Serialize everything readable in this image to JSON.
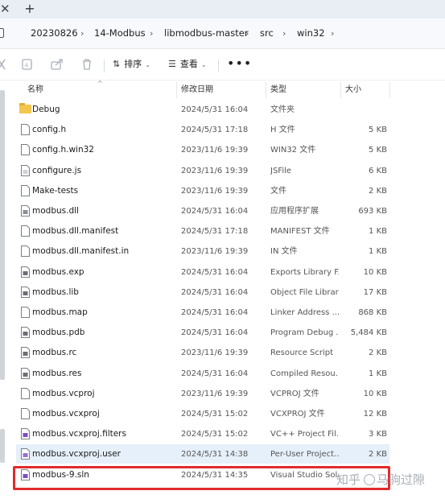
{
  "tabstrip": {
    "close_glyph": "✕",
    "new_tab_glyph": "+"
  },
  "breadcrumb": [
    "20230826",
    "14-Modbus",
    "libmodbus-master",
    "src",
    "win32"
  ],
  "toolbar": {
    "sort_label": "排序",
    "view_label": "查看",
    "more_label": "•••",
    "icons": [
      "rename-icon",
      "share-icon",
      "delete-icon",
      "sort-icon",
      "view-icon"
    ]
  },
  "columns": {
    "name": "名称",
    "date": "修改日期",
    "type": "类型",
    "size": "大小"
  },
  "files": [
    {
      "name": "Debug",
      "date": "2024/5/31 16:04",
      "type": "文件夹",
      "size": "",
      "icon": "folder-icon"
    },
    {
      "name": "config.h",
      "date": "2024/5/31 17:18",
      "type": "H 文件",
      "size": "5 KB",
      "icon": "file-icon"
    },
    {
      "name": "config.h.win32",
      "date": "2023/11/6 19:39",
      "type": "WIN32 文件",
      "size": "5 KB",
      "icon": "file-icon"
    },
    {
      "name": "configure.js",
      "date": "2023/11/6 19:39",
      "type": "JSFile",
      "size": "6 KB",
      "icon": "script-file-icon"
    },
    {
      "name": "Make-tests",
      "date": "2023/11/6 19:39",
      "type": "文件",
      "size": "2 KB",
      "icon": "file-icon"
    },
    {
      "name": "modbus.dll",
      "date": "2024/5/31 16:04",
      "type": "应用程序扩展",
      "size": "693 KB",
      "icon": "dll-file-icon"
    },
    {
      "name": "modbus.dll.manifest",
      "date": "2024/5/31 17:18",
      "type": "MANIFEST 文件",
      "size": "1 KB",
      "icon": "file-icon"
    },
    {
      "name": "modbus.dll.manifest.in",
      "date": "2023/11/6 19:39",
      "type": "IN 文件",
      "size": "1 KB",
      "icon": "file-icon"
    },
    {
      "name": "modbus.exp",
      "date": "2024/5/31 16:04",
      "type": "Exports Library F...",
      "size": "10 KB",
      "icon": "exp-file-icon"
    },
    {
      "name": "modbus.lib",
      "date": "2024/5/31 16:04",
      "type": "Object File Library",
      "size": "17 KB",
      "icon": "lib-file-icon"
    },
    {
      "name": "modbus.map",
      "date": "2024/5/31 16:04",
      "type": "Linker Address ...",
      "size": "868 KB",
      "icon": "file-icon"
    },
    {
      "name": "modbus.pdb",
      "date": "2024/5/31 16:04",
      "type": "Program Debug ...",
      "size": "5,484 KB",
      "icon": "pdb-file-icon"
    },
    {
      "name": "modbus.rc",
      "date": "2023/11/6 19:39",
      "type": "Resource Script",
      "size": "2 KB",
      "icon": "rc-file-icon"
    },
    {
      "name": "modbus.res",
      "date": "2024/5/31 16:04",
      "type": "Compiled Resou...",
      "size": "1 KB",
      "icon": "res-file-icon"
    },
    {
      "name": "modbus.vcproj",
      "date": "2023/11/6 19:39",
      "type": "VCPROJ 文件",
      "size": "10 KB",
      "icon": "file-icon"
    },
    {
      "name": "modbus.vcxproj",
      "date": "2024/5/31 15:02",
      "type": "VCXPROJ 文件",
      "size": "12 KB",
      "icon": "file-icon"
    },
    {
      "name": "modbus.vcxproj.filters",
      "date": "2024/5/31 15:02",
      "type": "VC++ Project Fil...",
      "size": "3 KB",
      "icon": "filters-file-icon"
    },
    {
      "name": "modbus.vcxproj.user",
      "date": "2024/5/31 14:38",
      "type": "Per-User Project...",
      "size": "2 KB",
      "icon": "user-file-icon"
    },
    {
      "name": "modbus-9.sln",
      "date": "2024/5/31 14:35",
      "type": "Visual Studio Sol...",
      "size": "",
      "icon": "sln-file-icon"
    }
  ],
  "watermark": {
    "left": "知乎",
    "right": "马驹过隙"
  },
  "colors": {
    "highlight": "#e02b2b",
    "hover_row": "#e6f0fb",
    "folder": "#f4c64d"
  }
}
